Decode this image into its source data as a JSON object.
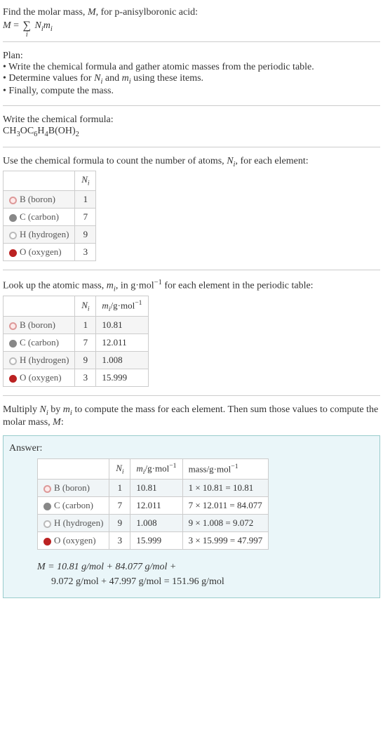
{
  "intro": {
    "line1_prefix": "Find the molar mass, ",
    "line1_var": "M",
    "line1_suffix": ", for p-anisylboronic acid:",
    "eq_lhs": "M",
    "eq_eq": " = ",
    "eq_sum_sub": "i",
    "eq_term1": "N",
    "eq_term1_sub": "i",
    "eq_term2": "m",
    "eq_term2_sub": "i"
  },
  "plan": {
    "title": "Plan:",
    "items": [
      "Write the chemical formula and gather atomic masses from the periodic table.",
      "Determine values for N_i and m_i using these items.",
      "Finally, compute the mass."
    ],
    "item2_prefix": "Determine values for ",
    "item2_v1": "N",
    "item2_v1s": "i",
    "item2_mid": " and ",
    "item2_v2": "m",
    "item2_v2s": "i",
    "item2_suffix": " using these items."
  },
  "chem": {
    "title": "Write the chemical formula:",
    "formula_parts": [
      "CH",
      "3",
      "OC",
      "6",
      "H",
      "4",
      "B(OH)",
      "2"
    ]
  },
  "count": {
    "title_prefix": "Use the chemical formula to count the number of atoms, ",
    "title_var": "N",
    "title_sub": "i",
    "title_suffix": ", for each element:",
    "header_ni": "N",
    "header_ni_sub": "i"
  },
  "lookup": {
    "title_prefix": "Look up the atomic mass, ",
    "title_var": "m",
    "title_sub": "i",
    "title_mid": ", in g·mol",
    "title_exp": "−1",
    "title_suffix": " for each element in the periodic table:",
    "header_mi": "m",
    "header_mi_sub": "i",
    "header_mi_unit": "/g·mol",
    "header_mi_exp": "−1"
  },
  "multiply": {
    "text_prefix": "Multiply ",
    "v1": "N",
    "v1s": "i",
    "mid1": " by ",
    "v2": "m",
    "v2s": "i",
    "mid2": " to compute the mass for each element. Then sum those values to compute the molar mass, ",
    "v3": "M",
    "suffix": ":"
  },
  "answer": {
    "label": "Answer:",
    "header_mass": "mass/g·mol",
    "header_mass_exp": "−1",
    "m_eq_line1": "M = 10.81 g/mol + 84.077 g/mol +",
    "m_eq_line2": "9.072 g/mol + 47.997 g/mol = 151.96 g/mol"
  },
  "chart_data": {
    "type": "table",
    "title": "Molar mass computation for p-anisylboronic acid CH3OC6H4B(OH)2",
    "columns": [
      "element",
      "N_i",
      "m_i (g/mol)",
      "mass (g/mol)",
      "mass_expr"
    ],
    "rows": [
      {
        "element": "B (boron)",
        "symbol": "B",
        "N_i": 1,
        "m_i": 10.81,
        "mass": 10.81,
        "mass_expr": "1 × 10.81 = 10.81"
      },
      {
        "element": "C (carbon)",
        "symbol": "C",
        "N_i": 7,
        "m_i": 12.011,
        "mass": 84.077,
        "mass_expr": "7 × 12.011 = 84.077"
      },
      {
        "element": "H (hydrogen)",
        "symbol": "H",
        "N_i": 9,
        "m_i": 1.008,
        "mass": 9.072,
        "mass_expr": "9 × 1.008 = 9.072"
      },
      {
        "element": "O (oxygen)",
        "symbol": "O",
        "N_i": 3,
        "m_i": 15.999,
        "mass": 47.997,
        "mass_expr": "3 × 15.999 = 47.997"
      }
    ],
    "molar_mass_total": 151.96,
    "molar_mass_unit": "g/mol"
  }
}
